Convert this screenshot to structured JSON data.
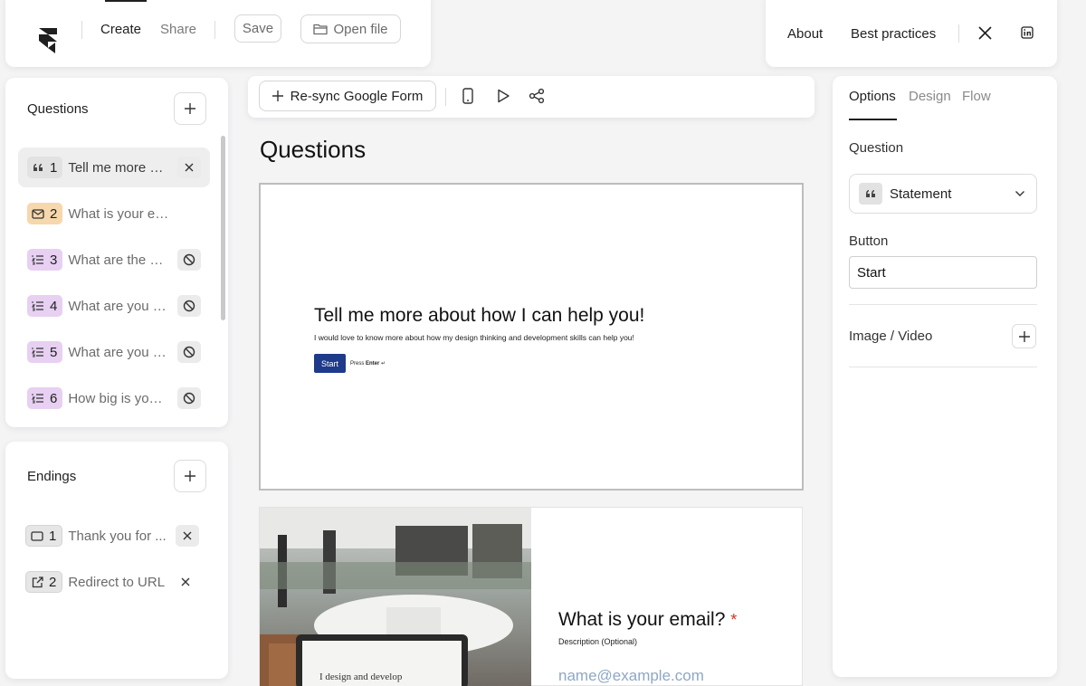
{
  "topbar": {
    "nav": [
      "Create",
      "Share"
    ],
    "save_label": "Save",
    "open_label": "Open file",
    "right_links": [
      "About",
      "Best practices"
    ],
    "icons": [
      "x-logo-icon",
      "linkedin-icon"
    ]
  },
  "questions_panel": {
    "title": "Questions",
    "items": [
      {
        "num": "1",
        "text": "Tell me more about how I can help you!",
        "badge_color": "#e2e2e2",
        "icon": "quote-icon",
        "action": "close-icon",
        "active": true
      },
      {
        "num": "2",
        "text": "What is your email?",
        "badge_color": "#f7d7ac",
        "icon": "mail-icon",
        "action": "",
        "active": false
      },
      {
        "num": "3",
        "text": "What are the main...",
        "badge_color": "#e7d0f2",
        "icon": "list-icon",
        "action": "ban-icon",
        "active": false
      },
      {
        "num": "4",
        "text": "What are you looking for...",
        "badge_color": "#e7d0f2",
        "icon": "list-icon",
        "action": "ban-icon",
        "active": false
      },
      {
        "num": "5",
        "text": "What are you looking for...",
        "badge_color": "#e7d0f2",
        "icon": "list-icon",
        "action": "ban-icon",
        "active": false
      },
      {
        "num": "6",
        "text": "How big is your...",
        "badge_color": "#e7d0f2",
        "icon": "list-icon",
        "action": "ban-icon",
        "active": false
      }
    ]
  },
  "endings_panel": {
    "title": "Endings",
    "items": [
      {
        "num": "1",
        "text": "Thank you for ...",
        "icon": "screen-icon"
      },
      {
        "num": "2",
        "text": "Redirect to URL",
        "icon": "external-link-icon"
      }
    ]
  },
  "toolbar": {
    "resync_label": "Re-sync Google Form",
    "icons": [
      "mobile-icon",
      "play-icon",
      "share-nodes-icon"
    ]
  },
  "main": {
    "title": "Questions",
    "preview1": {
      "heading": "Tell me more about how I can help you!",
      "description": "I would love to know more about how my design thinking and development skills can help you!",
      "button": "Start",
      "hint_prefix": "Press ",
      "hint_key": "Enter",
      "hint_suffix": " ↵"
    },
    "preview2": {
      "heading": "What is your email?",
      "required_mark": "*",
      "description": "Description (Optional)",
      "placeholder": "name@example.com",
      "laptop_text": "I design and develop"
    }
  },
  "right_panel": {
    "tabs": [
      "Options",
      "Design",
      "Flow"
    ],
    "question_label": "Question",
    "question_type": "Statement",
    "button_label": "Button",
    "button_value": "Start",
    "media_label": "Image / Video"
  },
  "colors": {
    "accent_button": "#1e3a8a",
    "required": "#d93025",
    "placeholder": "#8ea7c6"
  }
}
